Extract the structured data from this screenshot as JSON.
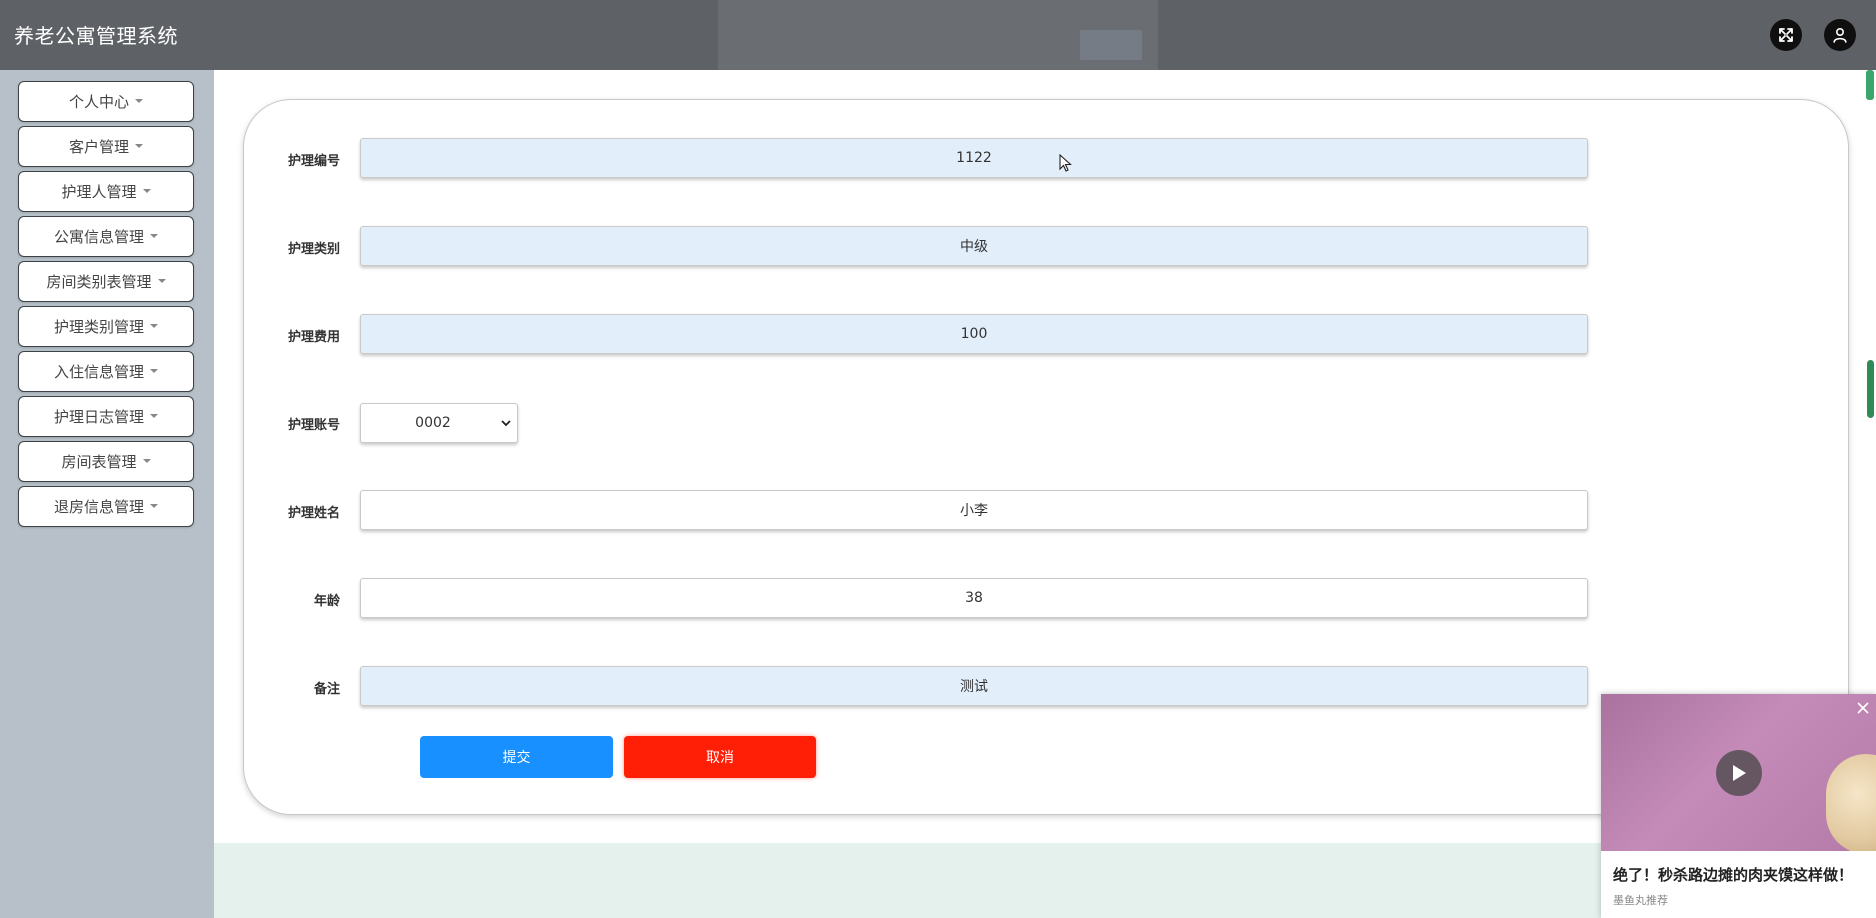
{
  "app": {
    "title": "养老公寓管理系统"
  },
  "header": {
    "icons": [
      "expand-icon",
      "user-icon"
    ]
  },
  "sidebar": {
    "items": [
      {
        "label": "个人中心"
      },
      {
        "label": "客户管理"
      },
      {
        "label": "护理人管理"
      },
      {
        "label": "公寓信息管理"
      },
      {
        "label": "房间类别表管理"
      },
      {
        "label": "护理类别管理"
      },
      {
        "label": "入住信息管理"
      },
      {
        "label": "护理日志管理"
      },
      {
        "label": "房间表管理"
      },
      {
        "label": "退房信息管理"
      }
    ]
  },
  "form": {
    "fields": {
      "code": {
        "label": "护理编号",
        "value": "1122"
      },
      "category": {
        "label": "护理类别",
        "value": "中级"
      },
      "fee": {
        "label": "护理费用",
        "value": "100"
      },
      "account": {
        "label": "护理账号",
        "value": "0002"
      },
      "name": {
        "label": "护理姓名",
        "value": "小李"
      },
      "age": {
        "label": "年龄",
        "value": "38"
      },
      "remark": {
        "label": "备注",
        "value": "测试"
      }
    },
    "submit_label": "提交",
    "cancel_label": "取消"
  },
  "ad": {
    "title": "绝了！秒杀路边摊的肉夹馍这样做！",
    "source": "墨鱼丸推荐"
  },
  "colors": {
    "header_bg": "#5e6166",
    "sidebar_bg": "#b7c0c8",
    "input_filled_bg": "#e3eefb",
    "submit": "#1890ff",
    "cancel": "#ff1e06"
  }
}
